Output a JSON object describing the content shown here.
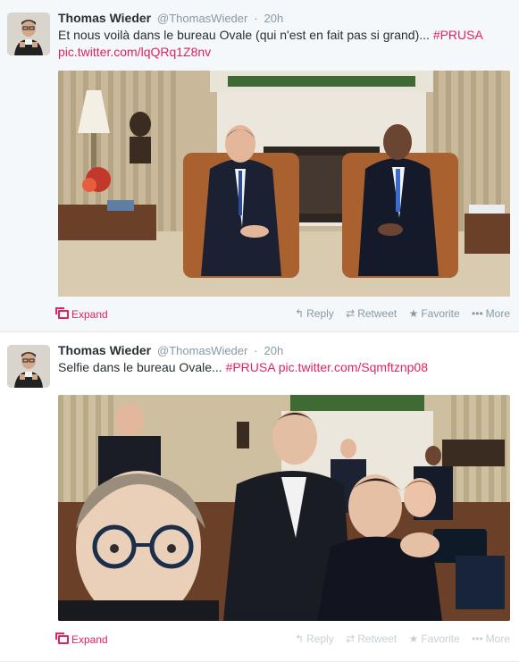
{
  "colors": {
    "accent": "#e0245e",
    "muted": "#8899a6",
    "name": "#292f33"
  },
  "tweets": [
    {
      "fullname": "Thomas Wieder",
      "screenname": "@ThomasWieder",
      "separator": "·",
      "time": "20h",
      "text_plain": "Et nous voilà dans le bureau Ovale (qui n'est en fait pas si grand)... ",
      "hashtag": "#PRUSA",
      "link": "pic.twitter.com/lqQRq1Z8nv",
      "expand": "Expand",
      "actions": {
        "reply": "Reply",
        "retweet": "Retweet",
        "favorite": "Favorite",
        "more": "More"
      }
    },
    {
      "fullname": "Thomas Wieder",
      "screenname": "@ThomasWieder",
      "separator": "·",
      "time": "20h",
      "text_plain": "Selfie dans le bureau Ovale... ",
      "hashtag": "#PRUSA",
      "link": "pic.twitter.com/Sqmftznp08",
      "expand": "Expand",
      "actions": {
        "reply": "Reply",
        "retweet": "Retweet",
        "favorite": "Favorite",
        "more": "More"
      }
    }
  ],
  "icons": {
    "reply": "reply-arrow-icon",
    "retweet": "retweet-icon",
    "favorite": "star-icon",
    "more": "more-dots-icon",
    "expand": "expand-media-icon"
  }
}
